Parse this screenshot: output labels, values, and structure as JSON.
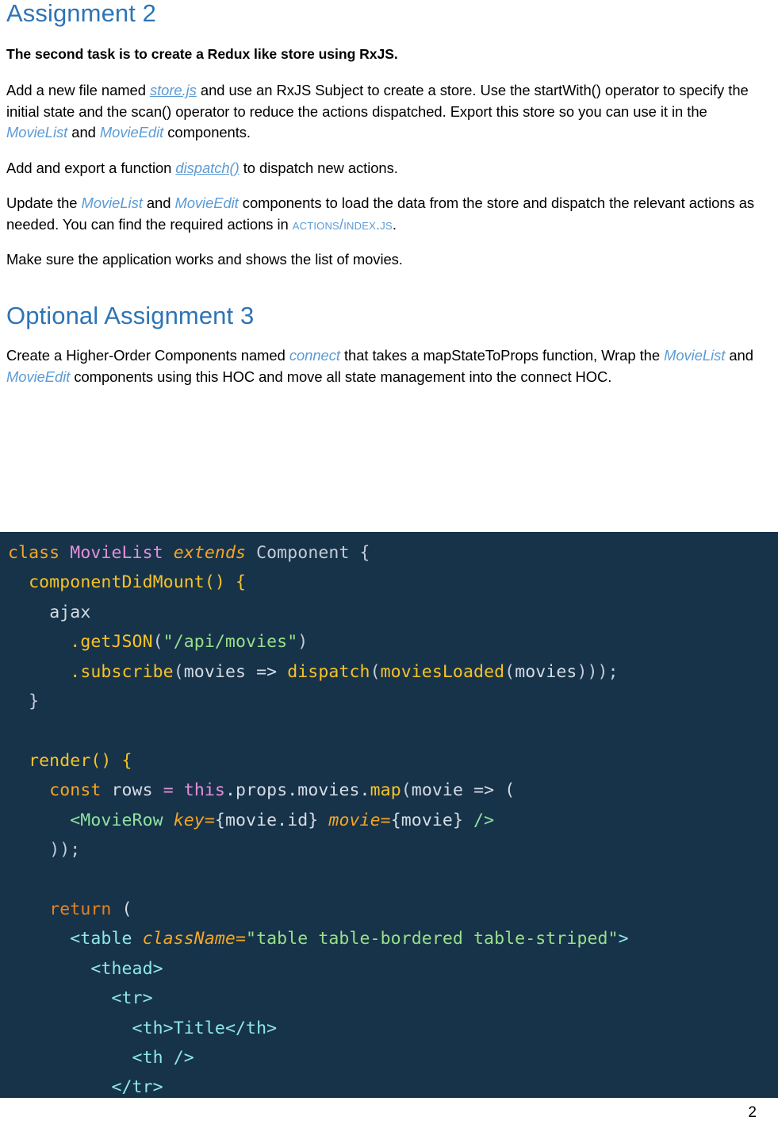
{
  "document": {
    "page_number": "2",
    "heading_1": "Assignment 2",
    "heading_2": "Optional Assignment 3",
    "intro_bold": "The second task is to create a Redux like store using RxJS.",
    "paragraphs": {
      "p1_a": "Add a new file named ",
      "p1_ref1": "store.js",
      "p1_b": " and use an RxJS Subject to create a store.  Use the startWith() operator to specify the initial state and the scan() operator to reduce the actions dispatched. Export this store so you can use it in the ",
      "p1_ref2": "MovieList",
      "p1_c": " and ",
      "p1_ref3": "MovieEdit",
      "p1_d": " components.",
      "p2_a": "Add and export a function ",
      "p2_ref1": "dispatch()",
      "p2_b": " to dispatch new actions.",
      "p3_a": "Update the ",
      "p3_ref1": "MovieList",
      "p3_b": " and ",
      "p3_ref2": "MovieEdit",
      "p3_c": " components to load the data from the store and dispatch the relevant actions as needed. You can find the required actions in ",
      "p3_ref3": "actions/index.js",
      "p3_d": ".",
      "p4": "Make sure the application works and shows the list of movies.",
      "p5_a": "Create a Higher-Order Components named ",
      "p5_ref1": "connect",
      "p5_b": " that takes a mapStateToProps function, Wrap the ",
      "p5_ref2": "MovieList",
      "p5_c": " and ",
      "p5_ref3": "MovieEdit",
      "p5_d": " components using this HOC and move all state management into the connect HOC."
    }
  },
  "code_block": {
    "language": "jsx",
    "background": "#17334a",
    "lines": [
      "class MovieList extends Component {",
      "  componentDidMount() {",
      "    ajax",
      "      .getJSON(\"/api/movies\")",
      "      .subscribe(movies => dispatch(moviesLoaded(movies)));",
      "  }",
      "",
      "  render() {",
      "    const rows = this.props.movies.map(movie => (",
      "      <MovieRow key={movie.id} movie={movie} />",
      "    ));",
      "",
      "    return (",
      "      <table className=\"table table-bordered table-striped\">",
      "        <thead>",
      "          <tr>",
      "            <th>Title</th>",
      "            <th />",
      "          </tr>"
    ]
  },
  "colors": {
    "heading_blue": "#2e74b5",
    "inline_ref_blue": "#5b9bd5",
    "code_bg": "#17334a",
    "code_keyword": "#f5a623",
    "code_return": "#e8821e",
    "code_class": "#e58fd8",
    "code_function": "#f7c325",
    "code_string": "#99e08a",
    "code_tag": "#8ee8e8",
    "code_component": "#8fe3a0",
    "code_plain": "#d6dce4"
  }
}
